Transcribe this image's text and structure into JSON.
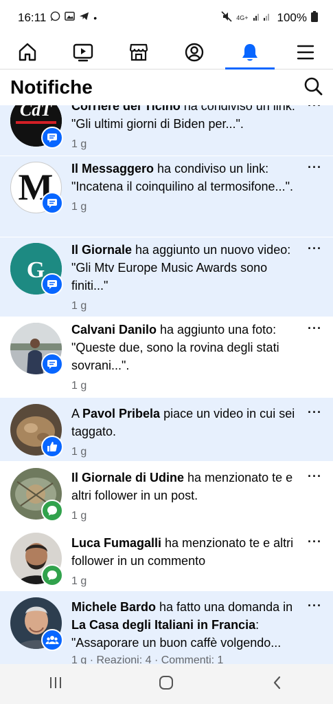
{
  "status": {
    "time": "16:11",
    "net": "4G+",
    "battery": "100%"
  },
  "page": {
    "title": "Notifiche"
  },
  "notifications": [
    {
      "name": "Corriere del Ticino",
      "action": " ha condiviso un link: \"Gli ultimi giorni di Biden per...\".",
      "time": "1 g"
    },
    {
      "name": "Il Messaggero",
      "action": " ha condiviso un link: \"Incatena il coinquilino al termosifone...\".",
      "time": "1 g"
    },
    {
      "name": "Il Giornale",
      "action": " ha aggiunto un nuovo video: \"Gli Mtv Europe Music Awards sono finiti...\"",
      "time": "1 g"
    },
    {
      "name": "Calvani Danilo",
      "action": " ha aggiunto una foto: \"Queste due, sono la rovina degli stati sovrani...\".",
      "time": "1 g"
    },
    {
      "prefix": "A ",
      "name": "Pavol Pribela",
      "action": " piace un video in cui sei taggato.",
      "time": "1 g"
    },
    {
      "name": "Il Giornale di Udine",
      "action": " ha menzionato te e altri follower in un post.",
      "time": "1 g"
    },
    {
      "name": "Luca Fumagalli",
      "action": " ha menzionato te e altri follower in un commento",
      "time": "1 g"
    },
    {
      "name": "Michele Bardo",
      "action": " ha fatto una domanda in ",
      "group": "La Casa degli Italiani in Francia",
      "action2": ": \"Assaporare un buon caffè volgendo...",
      "time": "1 g · Reazioni: 4 · Commenti: 1"
    }
  ],
  "avatars": {
    "cdt": "CdT",
    "messaggero": "M",
    "giornale": "G"
  }
}
